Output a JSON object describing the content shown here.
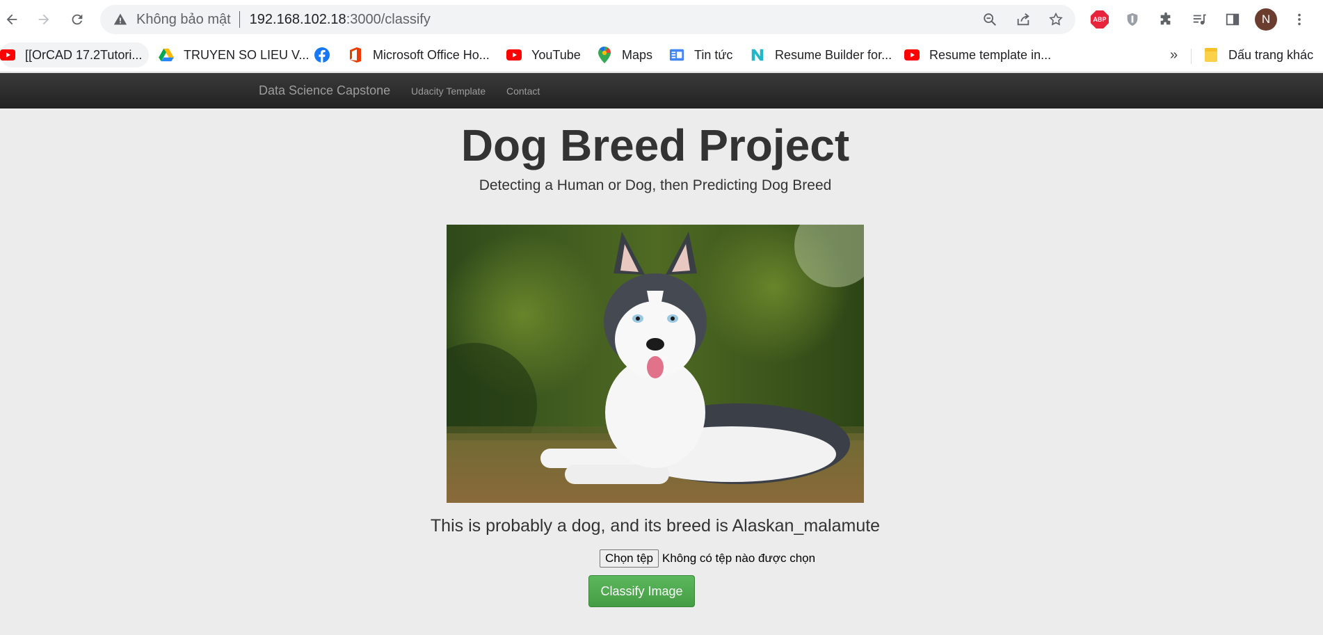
{
  "browser": {
    "security_label": "Không bảo mật",
    "url_host": "192.168.102.18",
    "url_rest": ":3000/classify",
    "profile_initial": "N",
    "extension_abp_label": "ABP"
  },
  "bookmarks": {
    "items": [
      {
        "label": "[[OrCAD 17.2Tutori...",
        "icon": "youtube-icon"
      },
      {
        "label": "TRUYEN SO LIEU V...",
        "icon": "google-drive-icon"
      },
      {
        "label": "",
        "icon": "facebook-icon"
      },
      {
        "label": "Microsoft Office Ho...",
        "icon": "office-icon"
      },
      {
        "label": "YouTube",
        "icon": "youtube-icon"
      },
      {
        "label": "Maps",
        "icon": "maps-icon"
      },
      {
        "label": "Tin tức",
        "icon": "google-news-icon"
      },
      {
        "label": "Resume Builder for...",
        "icon": "n-logo-icon"
      },
      {
        "label": "Resume template in...",
        "icon": "youtube-icon"
      }
    ],
    "overflow_label": "»",
    "other_label": "Dấu trang khác"
  },
  "navbar": {
    "brand": "Data Science Capstone",
    "links": [
      "Udacity Template",
      "Contact"
    ]
  },
  "page": {
    "title": "Dog Breed Project",
    "subtitle": "Detecting a Human or Dog, then Predicting Dog Breed",
    "result": "This is probably a dog, and its breed is Alaskan_malamute",
    "file_button": "Chọn tệp",
    "file_status": "Không có tệp nào được chọn",
    "classify_button": "Classify Image"
  },
  "colors": {
    "navbar": "#222222",
    "classify_button": "#449d44",
    "page_bg": "#ececec"
  }
}
